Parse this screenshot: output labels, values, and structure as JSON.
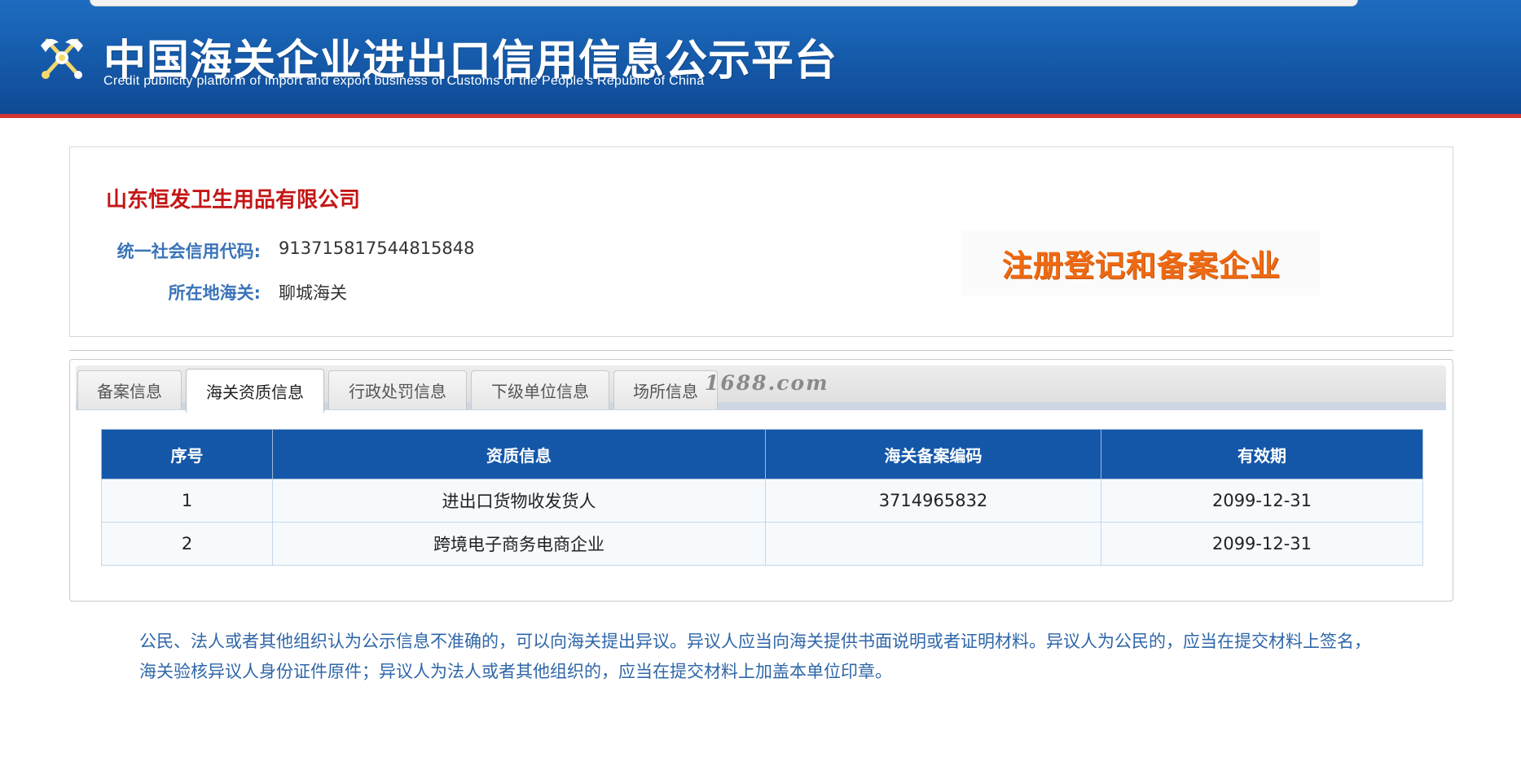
{
  "header": {
    "title_cn": "中国海关企业进出口信用信息公示平台",
    "title_en": "Credit publicity platform of import and export business of Customs of the People's Republic of China",
    "logo_icon": "customs-emblem-icon"
  },
  "company": {
    "name": "山东恒发卫生用品有限公司",
    "credit_code_label": "统一社会信用代码:",
    "credit_code": "913715817544815848",
    "customs_label": "所在地海关:",
    "customs": "聊城海关",
    "badge": "注册登记和备案企业"
  },
  "tabs": [
    {
      "label": "备案信息",
      "active": false
    },
    {
      "label": "海关资质信息",
      "active": true
    },
    {
      "label": "行政处罚信息",
      "active": false
    },
    {
      "label": "下级单位信息",
      "active": false
    },
    {
      "label": "场所信息",
      "active": false
    }
  ],
  "watermark": "1688.com",
  "table": {
    "headers": [
      "序号",
      "资质信息",
      "海关备案编码",
      "有效期"
    ],
    "rows": [
      [
        "1",
        "进出口货物收发货人",
        "3714965832",
        "2099-12-31"
      ],
      [
        "2",
        "跨境电子商务电商企业",
        "",
        "2099-12-31"
      ]
    ]
  },
  "notice": "公民、法人或者其他组织认为公示信息不准确的，可以向海关提出异议。异议人应当向海关提供书面说明或者证明材料。异议人为公民的，应当在提交材料上签名，海关验核异议人身份证件原件；异议人为法人或者其他组织的，应当在提交材料上加盖本单位印章。",
  "colors": {
    "header_blue": "#1559a9",
    "accent_red": "#d43434",
    "company_red": "#c41616",
    "label_blue": "#3a74b8",
    "badge_orange": "#ee6a12",
    "table_header": "#1457a8"
  }
}
